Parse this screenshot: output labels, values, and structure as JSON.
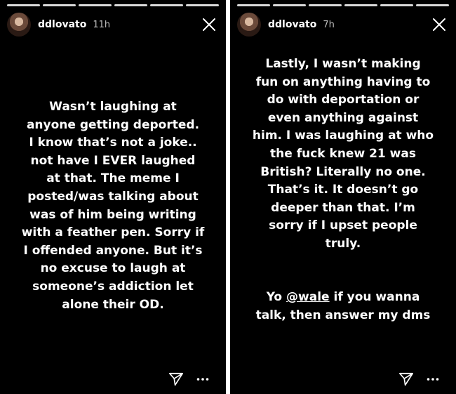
{
  "stories": [
    {
      "username": "ddlovato",
      "time": "11h",
      "lines": [
        "Wasn’t laughing at",
        "anyone getting deported.",
        "I know that’s not a joke..",
        "not have I EVER laughed",
        "at that. The meme I",
        "posted/was talking about",
        "was of him being writing",
        "with a feather pen. Sorry if",
        "I offended anyone. But it’s",
        "no excuse to laugh at",
        "someone’s addiction let",
        "alone their OD."
      ],
      "icons": {
        "close": "close-icon",
        "send": "send-icon",
        "more": "more-icon"
      }
    },
    {
      "username": "ddlovato",
      "time": "7h",
      "lines": [
        "Lastly, I wasn’t making",
        "fun on anything having to",
        "do with deportation or",
        "even anything against",
        "him. I was laughing at who",
        "the fuck knew 21 was",
        "British? Literally no one.",
        "That’s it. It doesn’t go",
        "deeper than that. I’m",
        "sorry if I upset people",
        "truly."
      ],
      "second_line1_prefix": "Yo ",
      "mention": "@wale",
      "second_line1_suffix": " if you wanna",
      "second_line2": "talk, then answer my dms",
      "icons": {
        "close": "close-icon",
        "send": "send-icon",
        "more": "more-icon"
      }
    }
  ],
  "colors": {
    "background": "#000000",
    "text": "#ffffff",
    "timestamp": "#bdbdbd"
  }
}
